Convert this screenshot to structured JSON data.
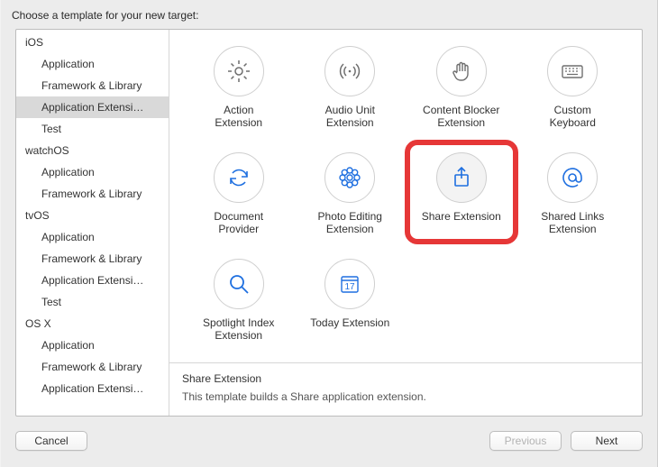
{
  "header": {
    "prompt": "Choose a template for your new target:"
  },
  "sidebar": {
    "groups": [
      {
        "label": "iOS",
        "items": [
          "Application",
          "Framework & Library",
          "Application Extensi…",
          "Test"
        ],
        "selected_index": 2
      },
      {
        "label": "watchOS",
        "items": [
          "Application",
          "Framework & Library"
        ]
      },
      {
        "label": "tvOS",
        "items": [
          "Application",
          "Framework & Library",
          "Application Extensi…",
          "Test"
        ]
      },
      {
        "label": "OS X",
        "items": [
          "Application",
          "Framework & Library",
          "Application Extensi…"
        ]
      }
    ]
  },
  "templates": [
    {
      "id": "action",
      "label": "Action\nExtension",
      "icon": "gear-icon"
    },
    {
      "id": "audio-unit",
      "label": "Audio Unit\nExtension",
      "icon": "audio-waves-icon"
    },
    {
      "id": "content-blocker",
      "label": "Content Blocker\nExtension",
      "icon": "hand-icon"
    },
    {
      "id": "custom-keyboard",
      "label": "Custom\nKeyboard",
      "icon": "keyboard-icon"
    },
    {
      "id": "document-provider",
      "label": "Document\nProvider",
      "icon": "refresh-icon"
    },
    {
      "id": "photo-editing",
      "label": "Photo Editing\nExtension",
      "icon": "flower-icon"
    },
    {
      "id": "share",
      "label": "Share Extension",
      "icon": "share-icon",
      "selected": true,
      "callout": true
    },
    {
      "id": "shared-links",
      "label": "Shared Links\nExtension",
      "icon": "at-icon"
    },
    {
      "id": "spotlight",
      "label": "Spotlight Index\nExtension",
      "icon": "search-icon"
    },
    {
      "id": "today",
      "label": "Today Extension",
      "icon": "calendar-icon",
      "icon_text": "17"
    }
  ],
  "description": {
    "title": "Share Extension",
    "body": "This template builds a Share application extension."
  },
  "footer": {
    "cancel": "Cancel",
    "previous": "Previous",
    "next": "Next",
    "previous_enabled": false
  },
  "colors": {
    "blue": "#1e6fe0",
    "gray": "#6e6e6e",
    "callout": "#e63737"
  }
}
